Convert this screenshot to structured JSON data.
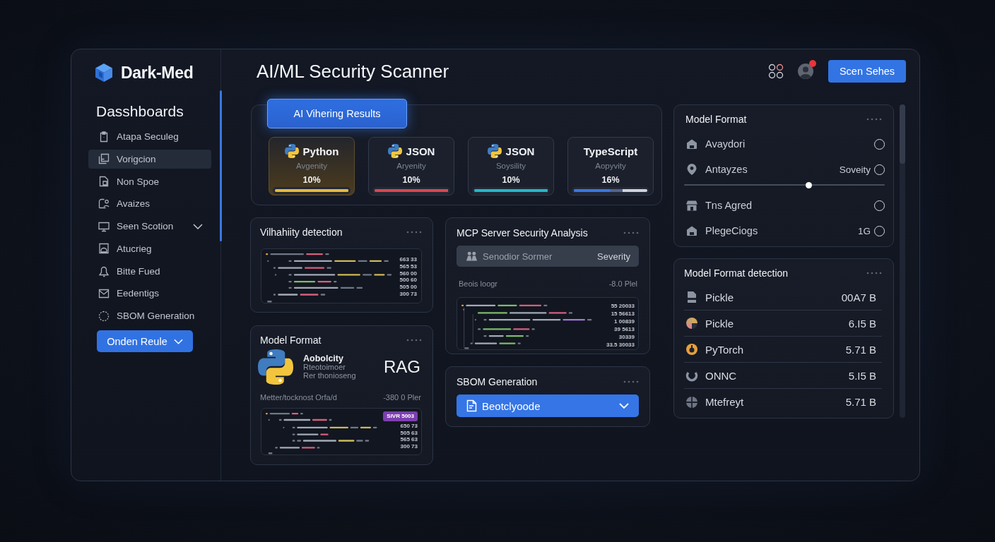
{
  "brand": {
    "name": "Dark-Med"
  },
  "sidebar": {
    "heading": "Dasshboards",
    "items": [
      {
        "label": "Atapa Seculeg",
        "selected": false,
        "expandable": false
      },
      {
        "label": "Vorigcion",
        "selected": true,
        "expandable": false
      },
      {
        "label": "Non Spoe",
        "selected": false,
        "expandable": false
      },
      {
        "label": "Avaizes",
        "selected": false,
        "expandable": false
      },
      {
        "label": "Seen Scotion",
        "selected": false,
        "expandable": true
      },
      {
        "label": "Atucrieg",
        "selected": false,
        "expandable": false
      },
      {
        "label": "Bitte Fued",
        "selected": false,
        "expandable": false
      },
      {
        "label": "Eedentigs",
        "selected": false,
        "expandable": false
      },
      {
        "label": "SBOM Generation",
        "selected": false,
        "expandable": false
      }
    ],
    "button": {
      "label": "Onden Reule"
    }
  },
  "header": {
    "title": "AI/ML Security Scanner",
    "notification": true,
    "button": {
      "label": "Scen Sehes"
    }
  },
  "results": {
    "tab": {
      "label": "AI Vihering Results",
      "selected": true
    },
    "cards": [
      {
        "title": "Python",
        "logo": true,
        "caption": "Avgenity",
        "value": "10%",
        "level": 1,
        "color": "#e8b93e",
        "selected": true
      },
      {
        "title": "JSON",
        "logo": true,
        "caption": "Aryenity",
        "value": "10%",
        "level": 1,
        "color": "#d9474f",
        "selected": false
      },
      {
        "title": "JSON",
        "logo": true,
        "caption": "Soysility",
        "value": "10%",
        "level": 1,
        "color": "#22b8c8",
        "selected": false
      },
      {
        "title": "TypeScript",
        "logo": false,
        "caption": "Aopyvity",
        "value": "16%",
        "level": 0.5,
        "color": "#3a78e0",
        "selected": false
      }
    ]
  },
  "vulnerability": {
    "title": "Vilhahiity detection",
    "values": [
      "663 33",
      "565 53",
      "560 00",
      "500 60",
      "505 00",
      "300 73"
    ]
  },
  "model_format_card": {
    "title": "Model Format",
    "name": "Aobolcity",
    "lines": [
      "Rteotoimoer",
      "Rer thonioseng"
    ],
    "tag": "RAG",
    "path": "Metter/tocknost Orfa/d",
    "path_value": "-380 0 Pler",
    "badge": "SIVR 5003",
    "values": [
      "650 73",
      "505 63",
      "565 63",
      "300 73"
    ]
  },
  "mcp": {
    "title": "MCP Server Security Analysis",
    "bar": {
      "label": "Senodior Sormer",
      "value": "Severity"
    },
    "log": "Beois loogr",
    "log_value": "-8.0 Plel",
    "values": [
      "55 20033",
      "15 56613",
      "1 00839",
      "39 5613",
      "30339",
      "33.5 30033"
    ]
  },
  "sbom": {
    "title": "SBOM Generation",
    "dropdown": {
      "value": "Beotclyoode"
    }
  },
  "model_format_panel": {
    "title": "Model Format",
    "rows": [
      {
        "kind": "option",
        "label": "Avaydori",
        "selected": false
      },
      {
        "kind": "option",
        "label": "Antayzes",
        "note": "Soveity",
        "selected": false
      },
      {
        "kind": "slider",
        "level": 0.62
      },
      {
        "kind": "option",
        "label": "Tns Agred",
        "selected": false
      },
      {
        "kind": "option",
        "label": "PlegeCiogs",
        "note": "1G",
        "selected": false
      }
    ]
  },
  "detection": {
    "title": "Model Format detection",
    "rows": [
      {
        "label": "Pickle",
        "size": "00A7 B"
      },
      {
        "label": "Pickle",
        "size": "6.I5 B"
      },
      {
        "label": "PyTorch",
        "size": "5.71 B"
      },
      {
        "label": "ONNC",
        "size": "5.I5 B"
      },
      {
        "label": "Mtefreyt",
        "size": "5.71 B"
      }
    ]
  }
}
